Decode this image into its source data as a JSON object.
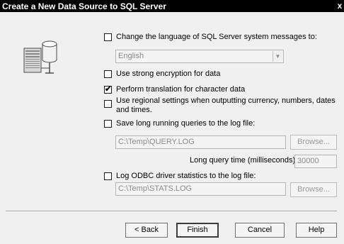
{
  "window": {
    "title": "Create a New Data Source to SQL Server",
    "close_glyph": "x"
  },
  "options": {
    "change_language": {
      "label": "Change the language of SQL Server system messages to:",
      "checked": false
    },
    "language_select": {
      "value": "English",
      "arrow": "▼"
    },
    "strong_encryption": {
      "label": "Use strong encryption for data",
      "checked": false
    },
    "perform_translation": {
      "label": "Perform translation for character data",
      "checked": true
    },
    "regional_settings": {
      "label": "Use regional settings when outputting currency, numbers, dates and times.",
      "checked": false
    },
    "save_long_queries": {
      "label": "Save long running queries to the log file:",
      "checked": false
    },
    "query_log_path": "C:\\Temp\\QUERY.LOG",
    "browse_query_label": "Browse...",
    "long_query_time_label": "Long query time (milliseconds):",
    "long_query_time_value": "30000",
    "log_odbc_stats": {
      "label": "Log ODBC driver statistics to the log file:",
      "checked": false
    },
    "stats_log_path": "C:\\Temp\\STATS.LOG",
    "browse_stats_label": "Browse..."
  },
  "check_glyph": "✔",
  "buttons": {
    "back": "< Back",
    "finish": "Finish",
    "cancel": "Cancel",
    "help": "Help"
  },
  "icons": {
    "graphic": "database-server-icon",
    "close": "close-icon",
    "dropdown": "chevron-down-icon"
  }
}
